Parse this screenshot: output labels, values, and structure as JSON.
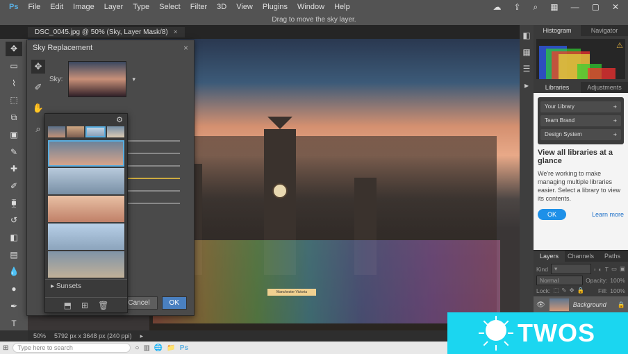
{
  "menubar": {
    "items": [
      "File",
      "Edit",
      "Image",
      "Layer",
      "Type",
      "Select",
      "Filter",
      "3D",
      "View",
      "Plugins",
      "Window",
      "Help"
    ]
  },
  "hint": "Drag to move the sky layer.",
  "document_tab": {
    "label": "DSC_0045.jpg @ 50% (Sky, Layer Mask/8)"
  },
  "dialog": {
    "title": "Sky Replacement",
    "sky_label": "Sky:",
    "buttons": {
      "cancel": "Cancel",
      "ok": "OK"
    }
  },
  "presets": {
    "folder": "Sunsets"
  },
  "right": {
    "hist_tabs": [
      "Histogram",
      "Navigator"
    ],
    "lib_tabs": [
      "Libraries",
      "Adjustments"
    ],
    "lib_preview_rows": [
      "Your Library",
      "Team Brand",
      "Design System"
    ],
    "lib_title": "View all libraries at a glance",
    "lib_text": "We're working to make managing multiple libraries easier. Select a library to view its contents.",
    "lib_ok": "OK",
    "lib_learn": "Learn more",
    "layers_tabs": [
      "Layers",
      "Channels",
      "Paths"
    ],
    "layers_kind": "Kind",
    "layers_blend": "Normal",
    "layers_opacity_label": "Opacity:",
    "layers_opacity": "100%",
    "layers_lock_label": "Lock:",
    "layers_fill_label": "Fill:",
    "layers_fill": "100%",
    "layer_name": "Background"
  },
  "statusbar": {
    "zoom": "50%",
    "doc": "5792 px x 3648 px (240 ppi)"
  },
  "taskbar": {
    "search": "Type here to search"
  },
  "watermark": "TWOS",
  "sign": "Manchester Victoria"
}
